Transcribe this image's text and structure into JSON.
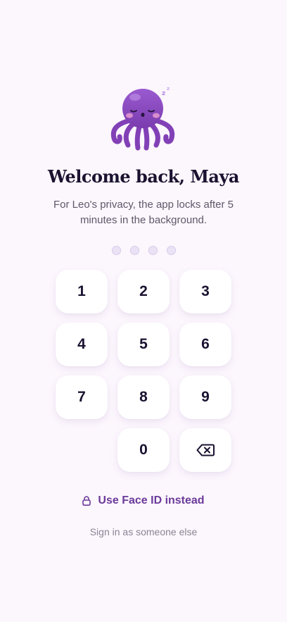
{
  "lock_screen": {
    "title": "Welcome back, Maya",
    "subtitle": "For Leo's privacy, the app locks after 5 minutes in the background.",
    "pin_length": 4,
    "pin_filled": 0,
    "keypad": {
      "keys": [
        "1",
        "2",
        "3",
        "4",
        "5",
        "6",
        "7",
        "8",
        "9",
        "",
        "0",
        "⌫"
      ]
    },
    "face_id_label": "Use Face ID instead",
    "switch_user_label": "Sign in as someone else"
  },
  "colors": {
    "background": "#FCF6FD",
    "accent": "#6B3A9A",
    "mascot_body": "#8E4CC0",
    "text_primary": "#1B1230",
    "text_secondary": "#5E586A",
    "pin_dot_empty": "#EAE3F5"
  },
  "icons": {
    "mascot": "sleeping-octopus-icon",
    "face_id": "lock-icon",
    "backspace": "backspace-icon"
  }
}
